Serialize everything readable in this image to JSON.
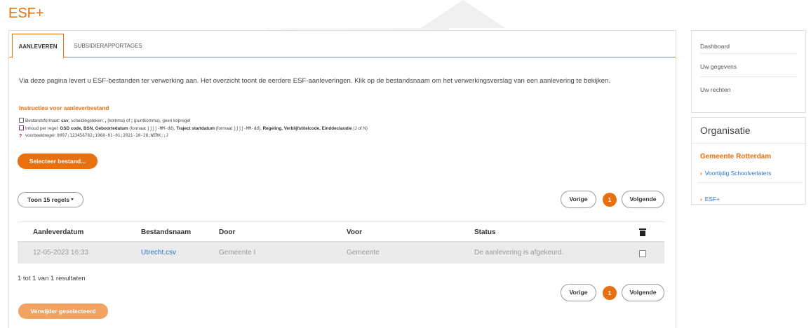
{
  "app": {
    "title": "ESF+"
  },
  "tabs": [
    {
      "label": "AANLEVEREN",
      "active": true
    },
    {
      "label": "SUBSIDIERAPPORTAGES",
      "active": false
    }
  ],
  "intro": "Via deze pagina levert u ESF-bestanden ter verwerking aan. Het overzicht toont de eerdere ESF-aanleveringen. Klik op de bestandsnaam om het verwerkingsverslag van een aanlevering te bekijken.",
  "instructions": {
    "title": "Instructies voor aanleverbestand",
    "format_prefix": "Bestandsformaat: ",
    "format_value": "csv",
    "format_mid": ", scheidingsteken: ",
    "format_sep1": ",",
    "format_mid2": " (komma) of ",
    "format_sep2": ";",
    "format_suffix": " (puntkomma), geen kopregel",
    "content_prefix": "Inhoud per regel: ",
    "content_fields1": "GSD code, BSN, Geboortedatum",
    "content_mid1": " (formaat ",
    "content_date1": "jjjj-MM-dd",
    "content_mid2": "), ",
    "content_fields2": "Traject startdatum",
    "content_mid3": " (formaat ",
    "content_date2": "jjjj-MM-dd",
    "content_mid4": "), ",
    "content_fields3": "Regeling, Verblijfstitelcode, Einddeclaratie",
    "content_suffix": " (J of N)",
    "example_prefix": "voorbeeldregel: ",
    "example_value": "0007;123456782;1960-01-01;2021-10-28;WERK;;J"
  },
  "buttons": {
    "select_file": "Selecteer bestand...",
    "show_rows": "Toon 15 regels",
    "previous": "Vorige",
    "next": "Volgende",
    "page": "1",
    "delete_selected": "Verwijder geselecteerd"
  },
  "table": {
    "headers": [
      "Aanleverdatum",
      "Bestandsnaam",
      "Door",
      "Voor",
      "Status"
    ],
    "rows": [
      {
        "date": "12-05-2023 16:33",
        "filename": "Utrecht.csv",
        "by": "Gemeente I",
        "for": "Gemeente",
        "status": "De aanlevering is afgekeurd.",
        "checked": false
      }
    ]
  },
  "result_text": "1 tot 1 van 1 resultaten",
  "sidebar": {
    "nav": [
      "Dashboard",
      "Uw gegevens",
      "Uw rechten"
    ],
    "org_title": "Organisatie",
    "org_name": "Gemeente Rotterdam",
    "org_links": [
      "Voortijdig Schoolverlaters",
      "ESF+"
    ]
  },
  "colors": {
    "accent": "#e8700f",
    "link": "#2a74c8"
  }
}
